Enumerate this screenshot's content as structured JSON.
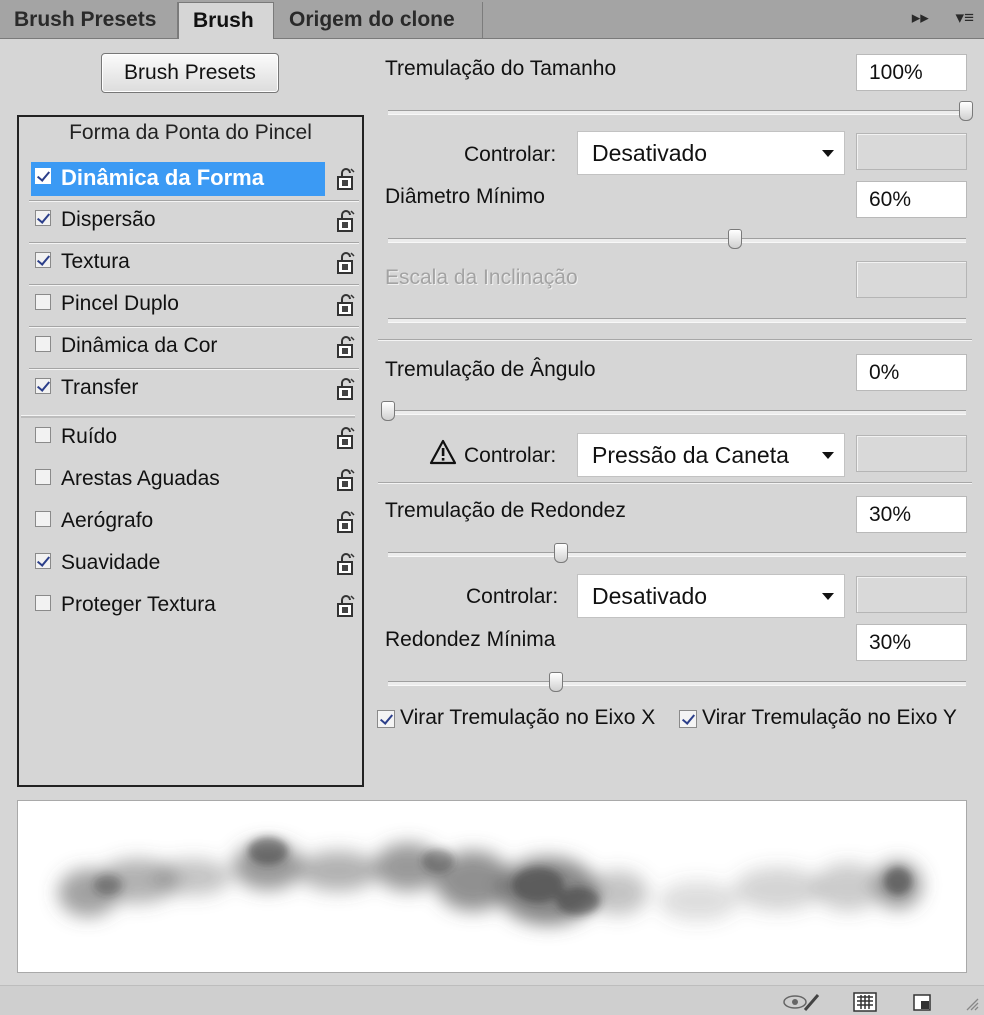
{
  "tabs": [
    {
      "label": "Brush Presets",
      "active": false
    },
    {
      "label": "Brush",
      "active": true
    },
    {
      "label": "Origem do clone",
      "active": false
    }
  ],
  "tabbar_icons": [
    "collapse-arrows-icon",
    "panel-menu-icon"
  ],
  "brush_presets_button": "Brush Presets",
  "list": {
    "header": "Forma da Ponta do Pincel",
    "items": [
      {
        "label": "Dinâmica da Forma",
        "checked": true,
        "selected": true
      },
      {
        "label": "Dispersão",
        "checked": true
      },
      {
        "label": "Textura",
        "checked": true
      },
      {
        "label": "Pincel Duplo",
        "checked": false
      },
      {
        "label": "Dinâmica da Cor",
        "checked": false
      },
      {
        "label": "Transfer",
        "checked": true
      },
      {
        "label": "Ruído",
        "checked": false
      },
      {
        "label": "Arestas Aguadas",
        "checked": false
      },
      {
        "label": "Aerógrafo",
        "checked": false
      },
      {
        "label": "Suavidade",
        "checked": true
      },
      {
        "label": "Proteger Textura",
        "checked": false
      }
    ]
  },
  "settings": {
    "size_jitter": {
      "label": "Tremulação do Tamanho",
      "value": "100%",
      "slider": 1.0
    },
    "control1": {
      "label": "Controlar:",
      "value": "Desativado"
    },
    "min_diameter": {
      "label": "Diâmetro Mínimo",
      "value": "60%",
      "slider": 0.6
    },
    "tilt_scale": {
      "label": "Escala da Inclinação",
      "enabled": false
    },
    "angle_jitter": {
      "label": "Tremulação de Ângulo",
      "value": "0%",
      "slider": 0.0
    },
    "control2": {
      "label": "Controlar:",
      "value": "Pressão da Caneta",
      "warning": true
    },
    "roundness_jitter": {
      "label": "Tremulação de Redondez",
      "value": "30%",
      "slider": 0.3
    },
    "control3": {
      "label": "Controlar:",
      "value": "Desativado"
    },
    "min_roundness": {
      "label": "Redondez Mínima",
      "value": "30%",
      "slider": 0.29
    },
    "flip_x": {
      "label": "Virar Tremulação no Eixo X",
      "checked": true
    },
    "flip_y": {
      "label": "Virar Tremulação no Eixo Y",
      "checked": true
    }
  },
  "bottom_icons": [
    "toggle-live-tip-icon",
    "brush-grid-icon",
    "create-new-brush-icon"
  ],
  "colors": {
    "selection": "#3b9af4",
    "panel": "#d6d6d6",
    "tabbar": "#a4a4a4"
  }
}
